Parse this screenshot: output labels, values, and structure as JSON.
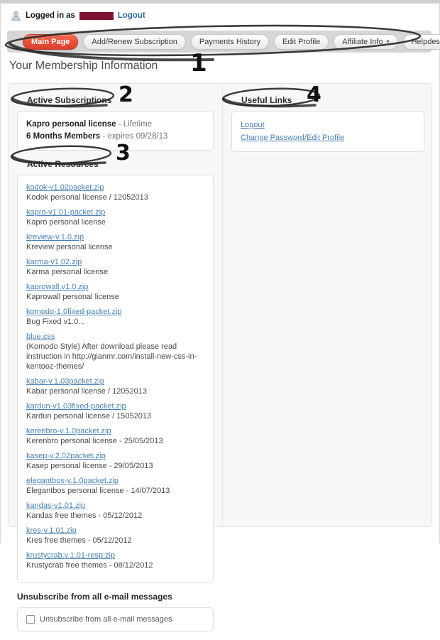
{
  "header": {
    "user_icon": "user-icon",
    "logged_in_label": "Logged in as",
    "username_redacted": "",
    "logout_label": "Logout"
  },
  "nav": {
    "tabs": [
      {
        "label": "Main Page",
        "active": true,
        "dropdown": false
      },
      {
        "label": "Add/Renew Subscription",
        "active": false,
        "dropdown": false
      },
      {
        "label": "Payments History",
        "active": false,
        "dropdown": false
      },
      {
        "label": "Edit Profile",
        "active": false,
        "dropdown": false
      },
      {
        "label": "Affiliate Info",
        "active": false,
        "dropdown": true
      },
      {
        "label": "Helpdesk",
        "active": false,
        "dropdown": false
      }
    ],
    "caret_glyph": "▾"
  },
  "page_title": "Your Membership Information",
  "sections": {
    "active_subscriptions": {
      "heading": "Active Subscriptions",
      "items": [
        {
          "name": "Kapro personal license",
          "detail": "- Lifetime"
        },
        {
          "name": "6 Months Members",
          "detail": "-  expires 09/28/13"
        }
      ]
    },
    "active_resources": {
      "heading": "Active Resources",
      "items": [
        {
          "link": "kodok-v1.02packet.zip",
          "desc": "Kodok personal license / 12052013"
        },
        {
          "link": "kapro-v1.01-packet.zip",
          "desc": "Kapro personal license"
        },
        {
          "link": "kreview-v.1.0.zip",
          "desc": "Kreview personal license"
        },
        {
          "link": "karma-v1.02.zip",
          "desc": "Karma personal license"
        },
        {
          "link": "kaprowall.v1.0.zip",
          "desc": "Kaprowall personal license"
        },
        {
          "link": "komodo-1.0fixed-packet.zip",
          "desc": "Bug Fixed v1.0..."
        },
        {
          "link": "blue.css",
          "desc": "(Komodo Style) After download please read instruction in http://gianmr.com/install-new-css-in-kentooz-themes/"
        },
        {
          "link": "kabar-v.1.03packet.zip",
          "desc": "Kabar personal license / 12052013"
        },
        {
          "link": "kardun-v1.03fixed-packet.zip",
          "desc": "Kardun personal license / 15052013"
        },
        {
          "link": "kerenbro-v.1.0packet.zip",
          "desc": "Kerenbro personal license - 25/05/2013"
        },
        {
          "link": "kasep-v.2.02packet.zip",
          "desc": "Kasep personal license - 29/05/2013"
        },
        {
          "link": "elegantbos-v.1.0packet.zip",
          "desc": "Elegantbos personal license - 14/07/2013"
        },
        {
          "link": "kandas-v1.01.zip",
          "desc": "Kandas free themes - 05/12/2012"
        },
        {
          "link": "kres-v.1.01.zip",
          "desc": "Kres free themes - 05/12/2012"
        },
        {
          "link": "krustycrab.v.1.01-resp.zip",
          "desc": "Krustycrab free themes - 08/12/2012"
        }
      ]
    },
    "unsubscribe": {
      "heading": "Unsubscribe from all e-mail messages",
      "checkbox_label": "Unsubscribe from all e-mail messages",
      "checked": false
    },
    "useful_links": {
      "heading": "Useful Links",
      "links": [
        {
          "label": "Logout"
        },
        {
          "label": "Change Password/Edit Profile"
        }
      ]
    }
  },
  "annotations": [
    {
      "number": "1",
      "target": "nav-bar"
    },
    {
      "number": "2",
      "target": "active-subscriptions-heading"
    },
    {
      "number": "3",
      "target": "active-resources-heading"
    },
    {
      "number": "4",
      "target": "useful-links-heading"
    }
  ],
  "colors": {
    "active_tab": "#e8503a",
    "link": "#4a82b5",
    "redaction": "#7d1231",
    "panel_bg": "#f7f7f7",
    "navbar_bg": "#d6d6d6"
  }
}
